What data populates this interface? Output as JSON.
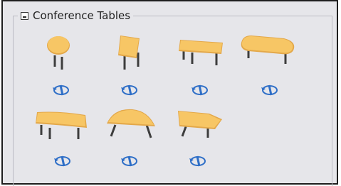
{
  "group": {
    "title": "Conference Tables"
  },
  "items": [
    {
      "shape": "round-table-icon"
    },
    {
      "shape": "square-table-icon"
    },
    {
      "shape": "rectangular-table-icon"
    },
    {
      "shape": "racetrack-table-icon"
    },
    {
      "shape": "boat-table-icon"
    },
    {
      "shape": "half-round-table-icon"
    },
    {
      "shape": "angled-table-icon"
    }
  ],
  "colors": {
    "tabletop": "#f7c665",
    "tabletop_edge": "#e3a84a",
    "legs": "#3d3d3d",
    "rotate_icon": "#2f6fc7"
  }
}
